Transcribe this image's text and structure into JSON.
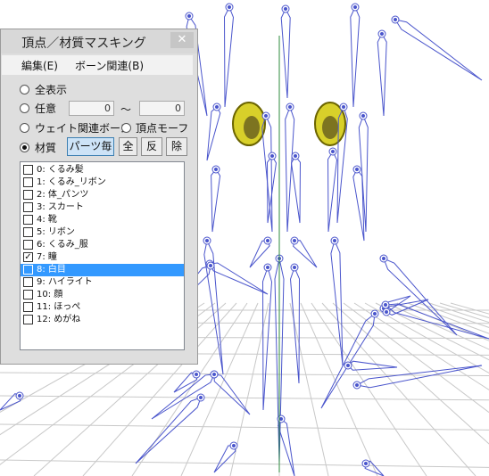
{
  "window": {
    "title": "頂点／材質マスキング",
    "close_glyph": "✕"
  },
  "menu": {
    "edit": "編集(E)",
    "bone": "ボーン関連(B)"
  },
  "options": {
    "show_all": "全表示",
    "arbitrary": "任意",
    "range_from": "0",
    "range_sep": "～",
    "range_to": "0",
    "weight_bone": "ウェイト関連ボーン",
    "vertex_morph": "頂点モーフ",
    "material": "材質",
    "per_part": "パーツ毎",
    "all": "全",
    "invert": "反",
    "remove": "除"
  },
  "materials": [
    {
      "label": "0: くるみ髪",
      "checked": false,
      "selected": false
    },
    {
      "label": "1: くるみ_リボン",
      "checked": false,
      "selected": false
    },
    {
      "label": "2: 体_パンツ",
      "checked": false,
      "selected": false
    },
    {
      "label": "3: スカート",
      "checked": false,
      "selected": false
    },
    {
      "label": "4: 靴",
      "checked": false,
      "selected": false
    },
    {
      "label": "5: リボン",
      "checked": false,
      "selected": false
    },
    {
      "label": "6: くるみ_服",
      "checked": false,
      "selected": false
    },
    {
      "label": "7: 瞳",
      "checked": true,
      "selected": false
    },
    {
      "label": "8: 白目",
      "checked": false,
      "selected": true
    },
    {
      "label": "9: ハイライト",
      "checked": false,
      "selected": false
    },
    {
      "label": "10: 顔",
      "checked": false,
      "selected": false
    },
    {
      "label": "11: ほっぺ",
      "checked": false,
      "selected": false
    },
    {
      "label": "12: めがね",
      "checked": false,
      "selected": false
    }
  ],
  "colors": {
    "bone": "#4a55cc",
    "grid": "#c8c8c8",
    "eye": "#d8d02a",
    "selection": "#3399ff"
  }
}
